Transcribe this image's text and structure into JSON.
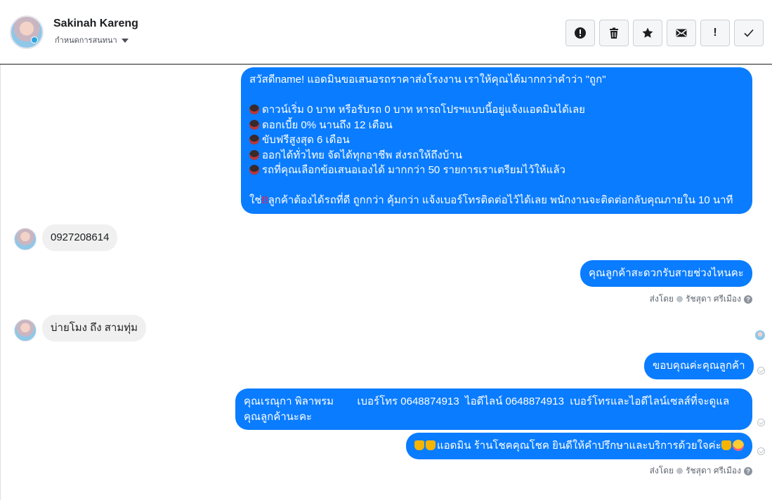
{
  "header": {
    "contact_name": "Sakinah Kareng",
    "assign_label": "กำหนดการสนทนา"
  },
  "actions": [
    {
      "name": "report-button",
      "icon": "alert-circle-icon"
    },
    {
      "name": "delete-button",
      "icon": "trash-icon"
    },
    {
      "name": "star-button",
      "icon": "star-icon"
    },
    {
      "name": "mark-unread-button",
      "icon": "envelope-icon"
    },
    {
      "name": "important-button",
      "icon": "exclamation-icon",
      "label": "!"
    },
    {
      "name": "done-button",
      "icon": "checkmark-icon"
    }
  ],
  "messages": {
    "promo": {
      "line1": "สวัสดีname! แอดมินขอเสนอรถราคาส่งโรงงาน เราให้คุณได้มากกว่าคำว่า \"ถูก\"",
      "bullets": [
        "ดาวน์เริ่ม 0 บาท หรือรับรถ 0 บาท หารถโปรฯแบบนี้อยู่แจ้งแอดมินได้เลย",
        "ดอกเบี้ย 0% นานถึง 12 เดือน",
        "ขับฟรีสูงสุด 6 เดือน",
        "ออกได้ทั่วไทย จัดได้ทุกอาชีพ ส่งรถให้ถึงบ้าน",
        "รถที่คุณเลือกข้อเสนอเองได้ มากกว่า 50 รายการเราเตรียมไว้ให้แล้ว"
      ],
      "closing_prefix": "ใช่",
      "closing_text": "ลูกค้าต้องได้รถที่ดี ถูกกว่า คุ้มกว่า แจ้งเบอร์โทรติดต่อไว้ได้เลย พนักงานจะติดต่อกลับคุณภายใน 10 นาที"
    },
    "in_phone": "0927208614",
    "out_ask_time": "คุณลูกค้าสะดวกรับสายช่วงไหนคะ",
    "sent_by_label": "ส่งโดย",
    "sent_by_name": "รัชสุดา ศรีเมือง",
    "in_time": "บ่ายโมง ถึง สามทุ่ม",
    "out_thanks": "ขอบคุณค่ะคุณลูกค้า",
    "out_agent_line1": "คุณเรณุกา พิลาพรม        เบอร์โทร 0648874913  ไอดีไลน์ 0648874913  เบอร์โทรและไอดีไลน์เซลส์ที่จะดูแล",
    "out_agent_line2": "คุณลูกค้านะคะ",
    "out_closing": "แอดมิน ร้านโชคคุณโชค ยินดีให้คำปรึกษาและบริการด้วยใจค่ะ",
    "help_icon_text": "?"
  },
  "colors": {
    "outgoing_bubble": "#0a7cff",
    "incoming_bubble": "#f0f0f0"
  }
}
